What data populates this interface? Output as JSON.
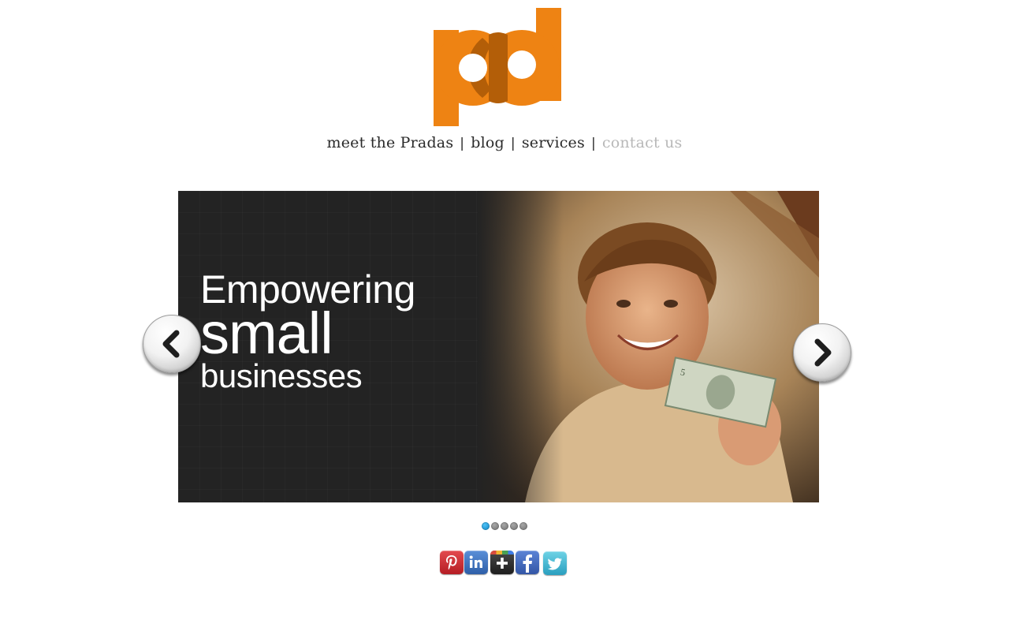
{
  "brand": {
    "logo_text": "pd",
    "logo_icon": "pd-logo",
    "primary_color": "#ee8313",
    "secondary_color": "#b35e08"
  },
  "nav": {
    "items": [
      {
        "label": "meet the Pradas",
        "active": false
      },
      {
        "label": "blog",
        "active": false
      },
      {
        "label": "services",
        "active": false
      },
      {
        "label": "contact us",
        "active": true
      }
    ],
    "separator": "|"
  },
  "slider": {
    "headline_line1": "Empowering",
    "headline_line2": "small",
    "headline_line3": "businesses",
    "prev_icon": "chevron-left-icon",
    "next_icon": "chevron-right-icon",
    "slide_count": 5,
    "active_slide": 1,
    "photo_description_icon": "boy-holding-dollar-photo"
  },
  "social": {
    "icons": [
      "pinterest-icon",
      "linkedin-icon",
      "google-plus-icon",
      "facebook-icon",
      "twitter-icon"
    ]
  }
}
